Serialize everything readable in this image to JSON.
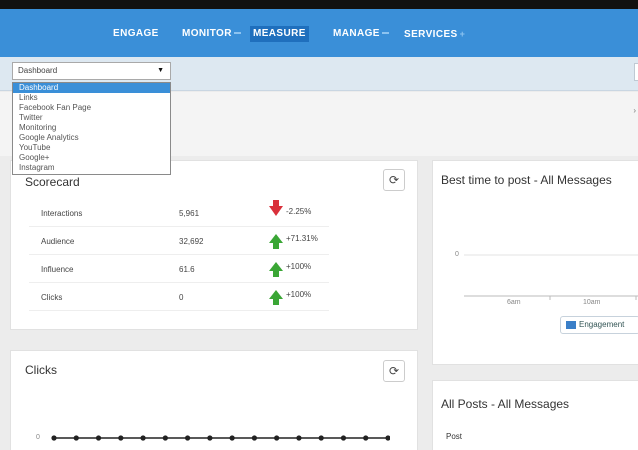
{
  "nav": {
    "items": [
      {
        "label": "ENGAGE",
        "has_caret": false,
        "has_plus": false,
        "active": false
      },
      {
        "label": "MONITOR",
        "has_caret": true,
        "has_plus": false,
        "active": false
      },
      {
        "label": "MEASURE",
        "has_caret": false,
        "has_plus": false,
        "active": true
      },
      {
        "label": "MANAGE",
        "has_caret": true,
        "has_plus": false,
        "active": false
      },
      {
        "label": "SERVICES",
        "has_caret": false,
        "has_plus": true,
        "active": false
      }
    ]
  },
  "view_select": {
    "selected": "Dashboard",
    "options": [
      "Dashboard",
      "Links",
      "Facebook Fan Page",
      "Twitter",
      "Monitoring",
      "Google Analytics",
      "YouTube",
      "Google+",
      "Instagram"
    ]
  },
  "scorecard": {
    "title": "Scorecard",
    "rows": [
      {
        "label": "Interactions",
        "value": "5,961",
        "change": "-2.25%",
        "trend": "down"
      },
      {
        "label": "Audience",
        "value": "32,692",
        "change": "+71.31%",
        "trend": "up"
      },
      {
        "label": "Influence",
        "value": "61.6",
        "change": "+100%",
        "trend": "up"
      },
      {
        "label": "Clicks",
        "value": "0",
        "change": "+100%",
        "trend": "up"
      }
    ]
  },
  "best_time": {
    "title": "Best time to post - All Messages",
    "y_tick": "0",
    "x_ticks": [
      "6am",
      "10am"
    ],
    "legend": "Engagement"
  },
  "clicks": {
    "title": "Clicks",
    "y_tick": "0",
    "point_count": 16
  },
  "all_posts": {
    "title": "All Posts - All Messages",
    "column": "Post"
  },
  "colors": {
    "nav_bg": "#3a8fd8",
    "nav_active": "#1f6fbd",
    "up": "#3aa635",
    "down": "#d9303a"
  }
}
